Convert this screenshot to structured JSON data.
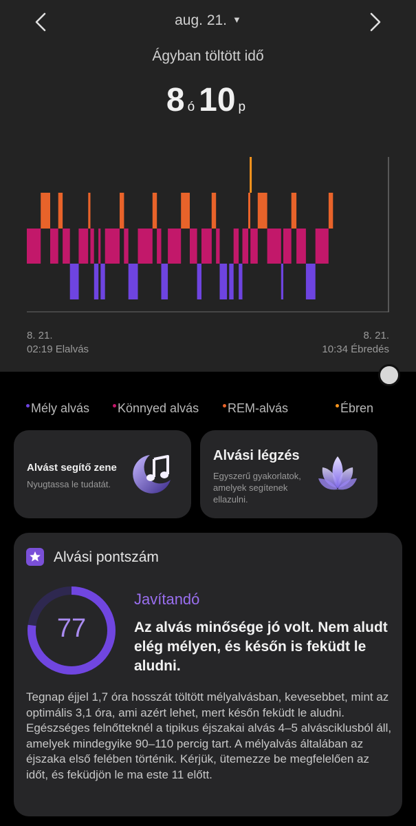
{
  "header": {
    "date": "aug. 21.",
    "title": "Ágyban töltött idő",
    "hours": "8",
    "hours_unit": "ó",
    "minutes": "10",
    "minutes_unit": "p",
    "prev_icon": "chevron-left-icon",
    "next_icon": "chevron-right-icon"
  },
  "chart_data": {
    "type": "timeline",
    "start": "02:19",
    "end": "10:34",
    "stages": [
      "awake",
      "rem",
      "light",
      "deep"
    ],
    "colors": {
      "awake": "#f7941d",
      "rem": "#e8632a",
      "light": "#c2186a",
      "deep": "#6e44e0"
    },
    "segments": [
      {
        "stage": "light",
        "from": "02:19",
        "to": "02:38"
      },
      {
        "stage": "rem",
        "from": "02:38",
        "to": "02:51"
      },
      {
        "stage": "light",
        "from": "02:51",
        "to": "03:02"
      },
      {
        "stage": "rem",
        "from": "03:02",
        "to": "03:08"
      },
      {
        "stage": "light",
        "from": "03:08",
        "to": "03:18"
      },
      {
        "stage": "deep",
        "from": "03:18",
        "to": "03:30"
      },
      {
        "stage": "light",
        "from": "03:30",
        "to": "03:43"
      },
      {
        "stage": "rem",
        "from": "03:43",
        "to": "03:46"
      },
      {
        "stage": "light",
        "from": "03:46",
        "to": "03:51"
      },
      {
        "stage": "deep",
        "from": "03:51",
        "to": "03:57"
      },
      {
        "stage": "light",
        "from": "03:57",
        "to": "04:00"
      },
      {
        "stage": "deep",
        "from": "04:00",
        "to": "04:06"
      },
      {
        "stage": "light",
        "from": "04:06",
        "to": "04:26"
      },
      {
        "stage": "rem",
        "from": "04:26",
        "to": "04:32"
      },
      {
        "stage": "light",
        "from": "04:32",
        "to": "04:38"
      },
      {
        "stage": "deep",
        "from": "04:38",
        "to": "04:51"
      },
      {
        "stage": "light",
        "from": "04:51",
        "to": "05:11"
      },
      {
        "stage": "rem",
        "from": "05:11",
        "to": "05:17"
      },
      {
        "stage": "light",
        "from": "05:17",
        "to": "05:23"
      },
      {
        "stage": "deep",
        "from": "05:23",
        "to": "05:32"
      },
      {
        "stage": "light",
        "from": "05:32",
        "to": "05:50"
      },
      {
        "stage": "rem",
        "from": "05:50",
        "to": "06:02"
      },
      {
        "stage": "light",
        "from": "06:02",
        "to": "06:12"
      },
      {
        "stage": "deep",
        "from": "06:12",
        "to": "06:18"
      },
      {
        "stage": "light",
        "from": "06:18",
        "to": "06:32"
      },
      {
        "stage": "rem",
        "from": "06:32",
        "to": "06:38"
      },
      {
        "stage": "light",
        "from": "06:38",
        "to": "06:43"
      },
      {
        "stage": "deep",
        "from": "06:43",
        "to": "06:53"
      },
      {
        "stage": "deep",
        "from": "06:56",
        "to": "07:02"
      },
      {
        "stage": "light",
        "from": "07:02",
        "to": "07:09"
      },
      {
        "stage": "deep",
        "from": "07:09",
        "to": "07:14"
      },
      {
        "stage": "light",
        "from": "07:14",
        "to": "07:22"
      },
      {
        "stage": "rem",
        "from": "07:22",
        "to": "07:24"
      },
      {
        "stage": "awake",
        "from": "07:24",
        "to": "07:25"
      },
      {
        "stage": "light",
        "from": "07:25",
        "to": "07:35"
      },
      {
        "stage": "rem",
        "from": "07:35",
        "to": "07:48"
      },
      {
        "stage": "light",
        "from": "07:48",
        "to": "08:07"
      },
      {
        "stage": "deep",
        "from": "08:07",
        "to": "08:10"
      },
      {
        "stage": "light",
        "from": "08:10",
        "to": "08:21"
      },
      {
        "stage": "rem",
        "from": "08:21",
        "to": "08:28"
      },
      {
        "stage": "light",
        "from": "08:28",
        "to": "08:41"
      },
      {
        "stage": "deep",
        "from": "08:41",
        "to": "08:54"
      },
      {
        "stage": "light",
        "from": "08:54",
        "to": "09:12"
      },
      {
        "stage": "rem",
        "from": "09:12",
        "to": "09:18"
      }
    ]
  },
  "axis": {
    "start_date": "8. 21.",
    "start_label": "02:19 Elalvás",
    "end_date": "8. 21.",
    "end_label": "10:34 Ébredés"
  },
  "legend": [
    {
      "label": "Mély alvás",
      "color": "#6e44e0"
    },
    {
      "label": "Könnyed alvás",
      "color": "#c2186a"
    },
    {
      "label": "REM-alvás",
      "color": "#e8632a"
    },
    {
      "label": "Ébren",
      "color": "#f7941d"
    }
  ],
  "cards": {
    "music": {
      "title": "Alvást segítő zene",
      "subtitle": "Nyugtassa le tudatát.",
      "icon": "moon-music-icon"
    },
    "breathing": {
      "title": "Alvási légzés",
      "subtitle_lines": [
        "Egyszerű gyakorlatok,",
        "amelyek segítenek",
        "ellazulni."
      ],
      "icon": "lotus-icon"
    }
  },
  "score": {
    "header": "Alvási pontszám",
    "icon": "star-badge-icon",
    "value": "77",
    "fraction": 0.77,
    "status": "Javítandó",
    "headline": "Az alvás minősége jó volt. Nem aludt elég mélyen, és későn is feküdt le aludni.",
    "body": "Tegnap éjjel 1,7 óra hosszát töltött mélyalvásban, kevesebbet, mint az optimális 3,1 óra, ami azért lehet, mert későn feküdt le aludni. Egészséges felnőtteknél a tipikus éjszakai alvás 4–5 alvásciklusból áll, amelyek mindegyike 90–110 percig tart. A mélyalvás általában az éjszaka első felében történik. Kérjük, ütemezze be megfelelően az időt, és feküdjön le ma este 11 előtt."
  }
}
